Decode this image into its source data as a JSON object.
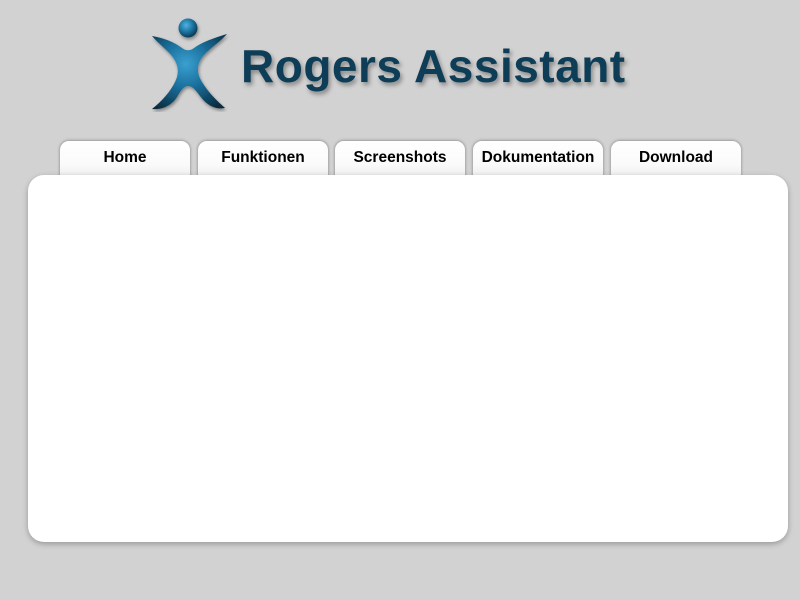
{
  "header": {
    "logo_icon": "person-figure-icon",
    "brand_name": "Rogers Assistant",
    "brand_color": "#0e3d57"
  },
  "nav": {
    "tabs": [
      {
        "label": "Home"
      },
      {
        "label": "Funktionen"
      },
      {
        "label": "Screenshots"
      },
      {
        "label": "Dokumentation"
      },
      {
        "label": "Download"
      }
    ]
  },
  "colors": {
    "background": "#d2d2d2",
    "panel": "#ffffff",
    "icon_blue": "#1a6f9c"
  }
}
